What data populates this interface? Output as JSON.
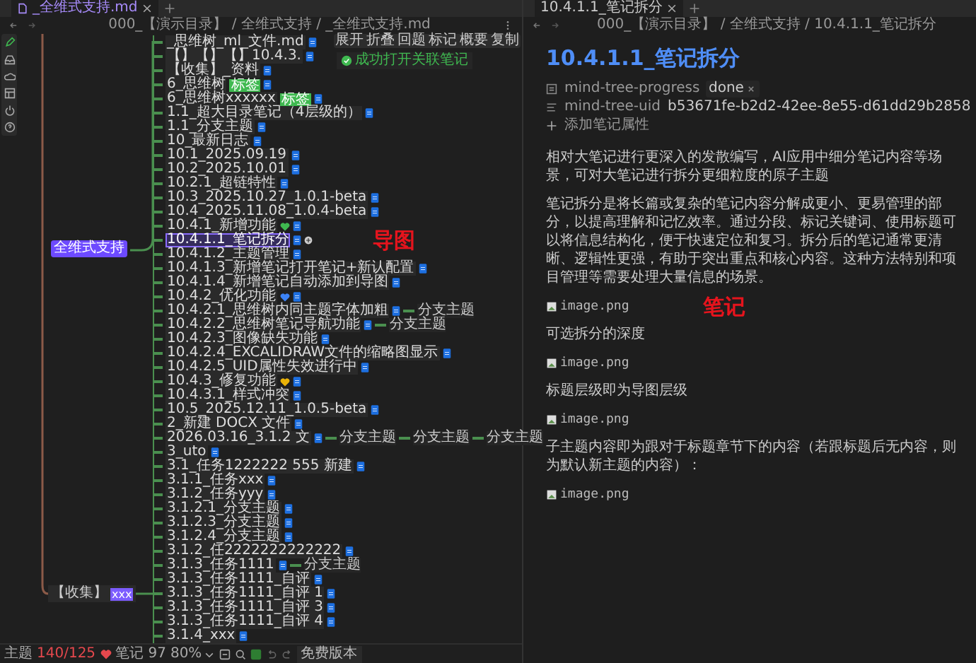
{
  "left_tab": {
    "title": "_全维式支持.md"
  },
  "left_breadcrumb": "000_【演示目录】 / 全维式支持 / _全维式支持.md",
  "node_toolbar": [
    "展开",
    "折叠",
    "回题",
    "标记",
    "概要",
    "复制"
  ],
  "toast": "成功打开关联笔记",
  "root_node": "全维式支持",
  "collect_node": {
    "label": "【收集】",
    "badge": "xxx"
  },
  "nodes": [
    {
      "text": "_思维树_ml_文件.md",
      "selected": false
    },
    {
      "text": "【】【】【】10.4.3.",
      "selected": false
    },
    {
      "text": "【收集】_资料",
      "selected": false
    },
    {
      "text": "6_思维树",
      "tag": "标签",
      "selected": false
    },
    {
      "text": "6_思维树xxxxxx",
      "tag": "标签",
      "selected": false
    },
    {
      "text": "1.1_超大目录笔记（4层级的）",
      "selected": false
    },
    {
      "text": "1.1_分支主题",
      "selected": false
    },
    {
      "text": "10_最新日志",
      "selected": false
    },
    {
      "text": "10.1_2025.09.19",
      "selected": false
    },
    {
      "text": "10.2_2025.10.01",
      "selected": false
    },
    {
      "text": "10.2.1_超链特性",
      "selected": false
    },
    {
      "text": "10.3_2025.10.27_1.0.1-beta",
      "selected": false
    },
    {
      "text": "10.4_2025.11.08_1.0.4-beta",
      "selected": false
    },
    {
      "text": "10.4.1_新增功能",
      "color": "#3fb950",
      "selected": false
    },
    {
      "text": "10.4.1.1_笔记拆分",
      "selected": true,
      "annotation": "导图"
    },
    {
      "text": "10.4.1.2_主题管理",
      "selected": false
    },
    {
      "text": "10.4.1.3_新增笔记打开笔记+新认配置",
      "selected": false
    },
    {
      "text": "10.4.1.4_新增笔记自动添加到导图",
      "selected": false
    },
    {
      "text": "10.4.2_优化功能",
      "color": "#3b82f6",
      "selected": false
    },
    {
      "text": "10.4.2.1_思维树内同主题字体加粗",
      "branches": [
        "分支主题"
      ],
      "selected": false
    },
    {
      "text": "10.4.2.2_思维树笔记导航功能",
      "branches": [
        "分支主题"
      ],
      "selected": false
    },
    {
      "text": "10.4.2.3_图像缺失功能",
      "selected": false
    },
    {
      "text": "10.4.2.4_EXCALIDRAW文件的缩略图显示",
      "selected": false
    },
    {
      "text": "10.4.2.5_UID属性失效进行中",
      "selected": false
    },
    {
      "text": "10.4.3_修复功能",
      "color": "#eab308",
      "selected": false
    },
    {
      "text": "10.4.3.1_样式冲突",
      "selected": false
    },
    {
      "text": "10.5_2025.12.11_1.0.5-beta",
      "selected": false
    },
    {
      "text": "2_新建 DOCX 文件",
      "selected": false
    },
    {
      "text": "2026.03.16_3.1.2 文",
      "branches": [
        "分支主题",
        "分支主题",
        "分支主题"
      ],
      "selected": false
    },
    {
      "text": "3_uto",
      "selected": false
    },
    {
      "text": "3.1_任务1222222 555 新建",
      "selected": false
    },
    {
      "text": "3.1.1_任务xxx",
      "selected": false
    },
    {
      "text": "3.1.2_任务yyy",
      "selected": false
    },
    {
      "text": "3.1.2.1_分支主题",
      "selected": false
    },
    {
      "text": "3.1.2.3_分支主题",
      "selected": false
    },
    {
      "text": "3.1.2.4_分支主题",
      "selected": false
    },
    {
      "text": "3.1.2_任2222222222222",
      "selected": false
    },
    {
      "text": "3.1.3_任务1111",
      "branches": [
        "分支主题"
      ],
      "selected": false
    },
    {
      "text": "3.1.3_任务1111_自评",
      "selected": false
    },
    {
      "text": "3.1.3_任务1111_自评 1",
      "selected": false
    },
    {
      "text": "3.1.3_任务1111_自评 3",
      "selected": false
    },
    {
      "text": "3.1.3_任务1111_自评 4",
      "selected": false
    },
    {
      "text": "3.1.4_xxx",
      "selected": false
    }
  ],
  "status_bar": {
    "theme_label": "主题",
    "theme_count": "140/125",
    "notes": "笔记 97",
    "zoom": "80%",
    "edition": "免费版本"
  },
  "right_tab": {
    "title": "10.4.1.1_笔记拆分"
  },
  "right_breadcrumb": "000_【演示目录】 / 全维式支持 / 10.4.1.1_笔记拆分",
  "note": {
    "title": "10.4.1.1_笔记拆分",
    "properties": [
      {
        "kind": "list",
        "name": "mind-tree-progress",
        "value": "done"
      },
      {
        "kind": "text",
        "name": "mind-tree-uid",
        "value": "b53671fe-b2d2-42ee-8e55-d61dd29b2858"
      }
    ],
    "add_property": "添加笔记属性",
    "blocks": [
      {
        "kind": "paragraph",
        "text": "相对大笔记进行更深入的发散编写，AI应用中细分笔记内容等场景，可对大笔记进行拆分更细粒度的原子主题"
      },
      {
        "kind": "paragraph",
        "text": "笔记拆分是将长篇或复杂的笔记内容分解成更小、更易管理的部分，以提高理解和记忆效率。通过分段、标记关键词、使用标题可以将信息结构化，便于快速定位和复习。拆分后的笔记通常更清晰、逻辑性更强，有助于突出重点和核心内容。这种方法特别和项目管理等需要处理大量信息的场景。"
      },
      {
        "kind": "image",
        "text": "image.png",
        "annotation": "笔记"
      },
      {
        "kind": "paragraph",
        "text": "可选拆分的深度"
      },
      {
        "kind": "image",
        "text": "image.png"
      },
      {
        "kind": "paragraph",
        "text": "标题层级即为导图层级"
      },
      {
        "kind": "image",
        "text": "image.png"
      },
      {
        "kind": "paragraph",
        "text": "子主题内容即为跟对于标题章节下的内容（若跟标题后无内容，则为默认新主题的内容）："
      },
      {
        "kind": "image",
        "text": "image.png"
      }
    ]
  }
}
